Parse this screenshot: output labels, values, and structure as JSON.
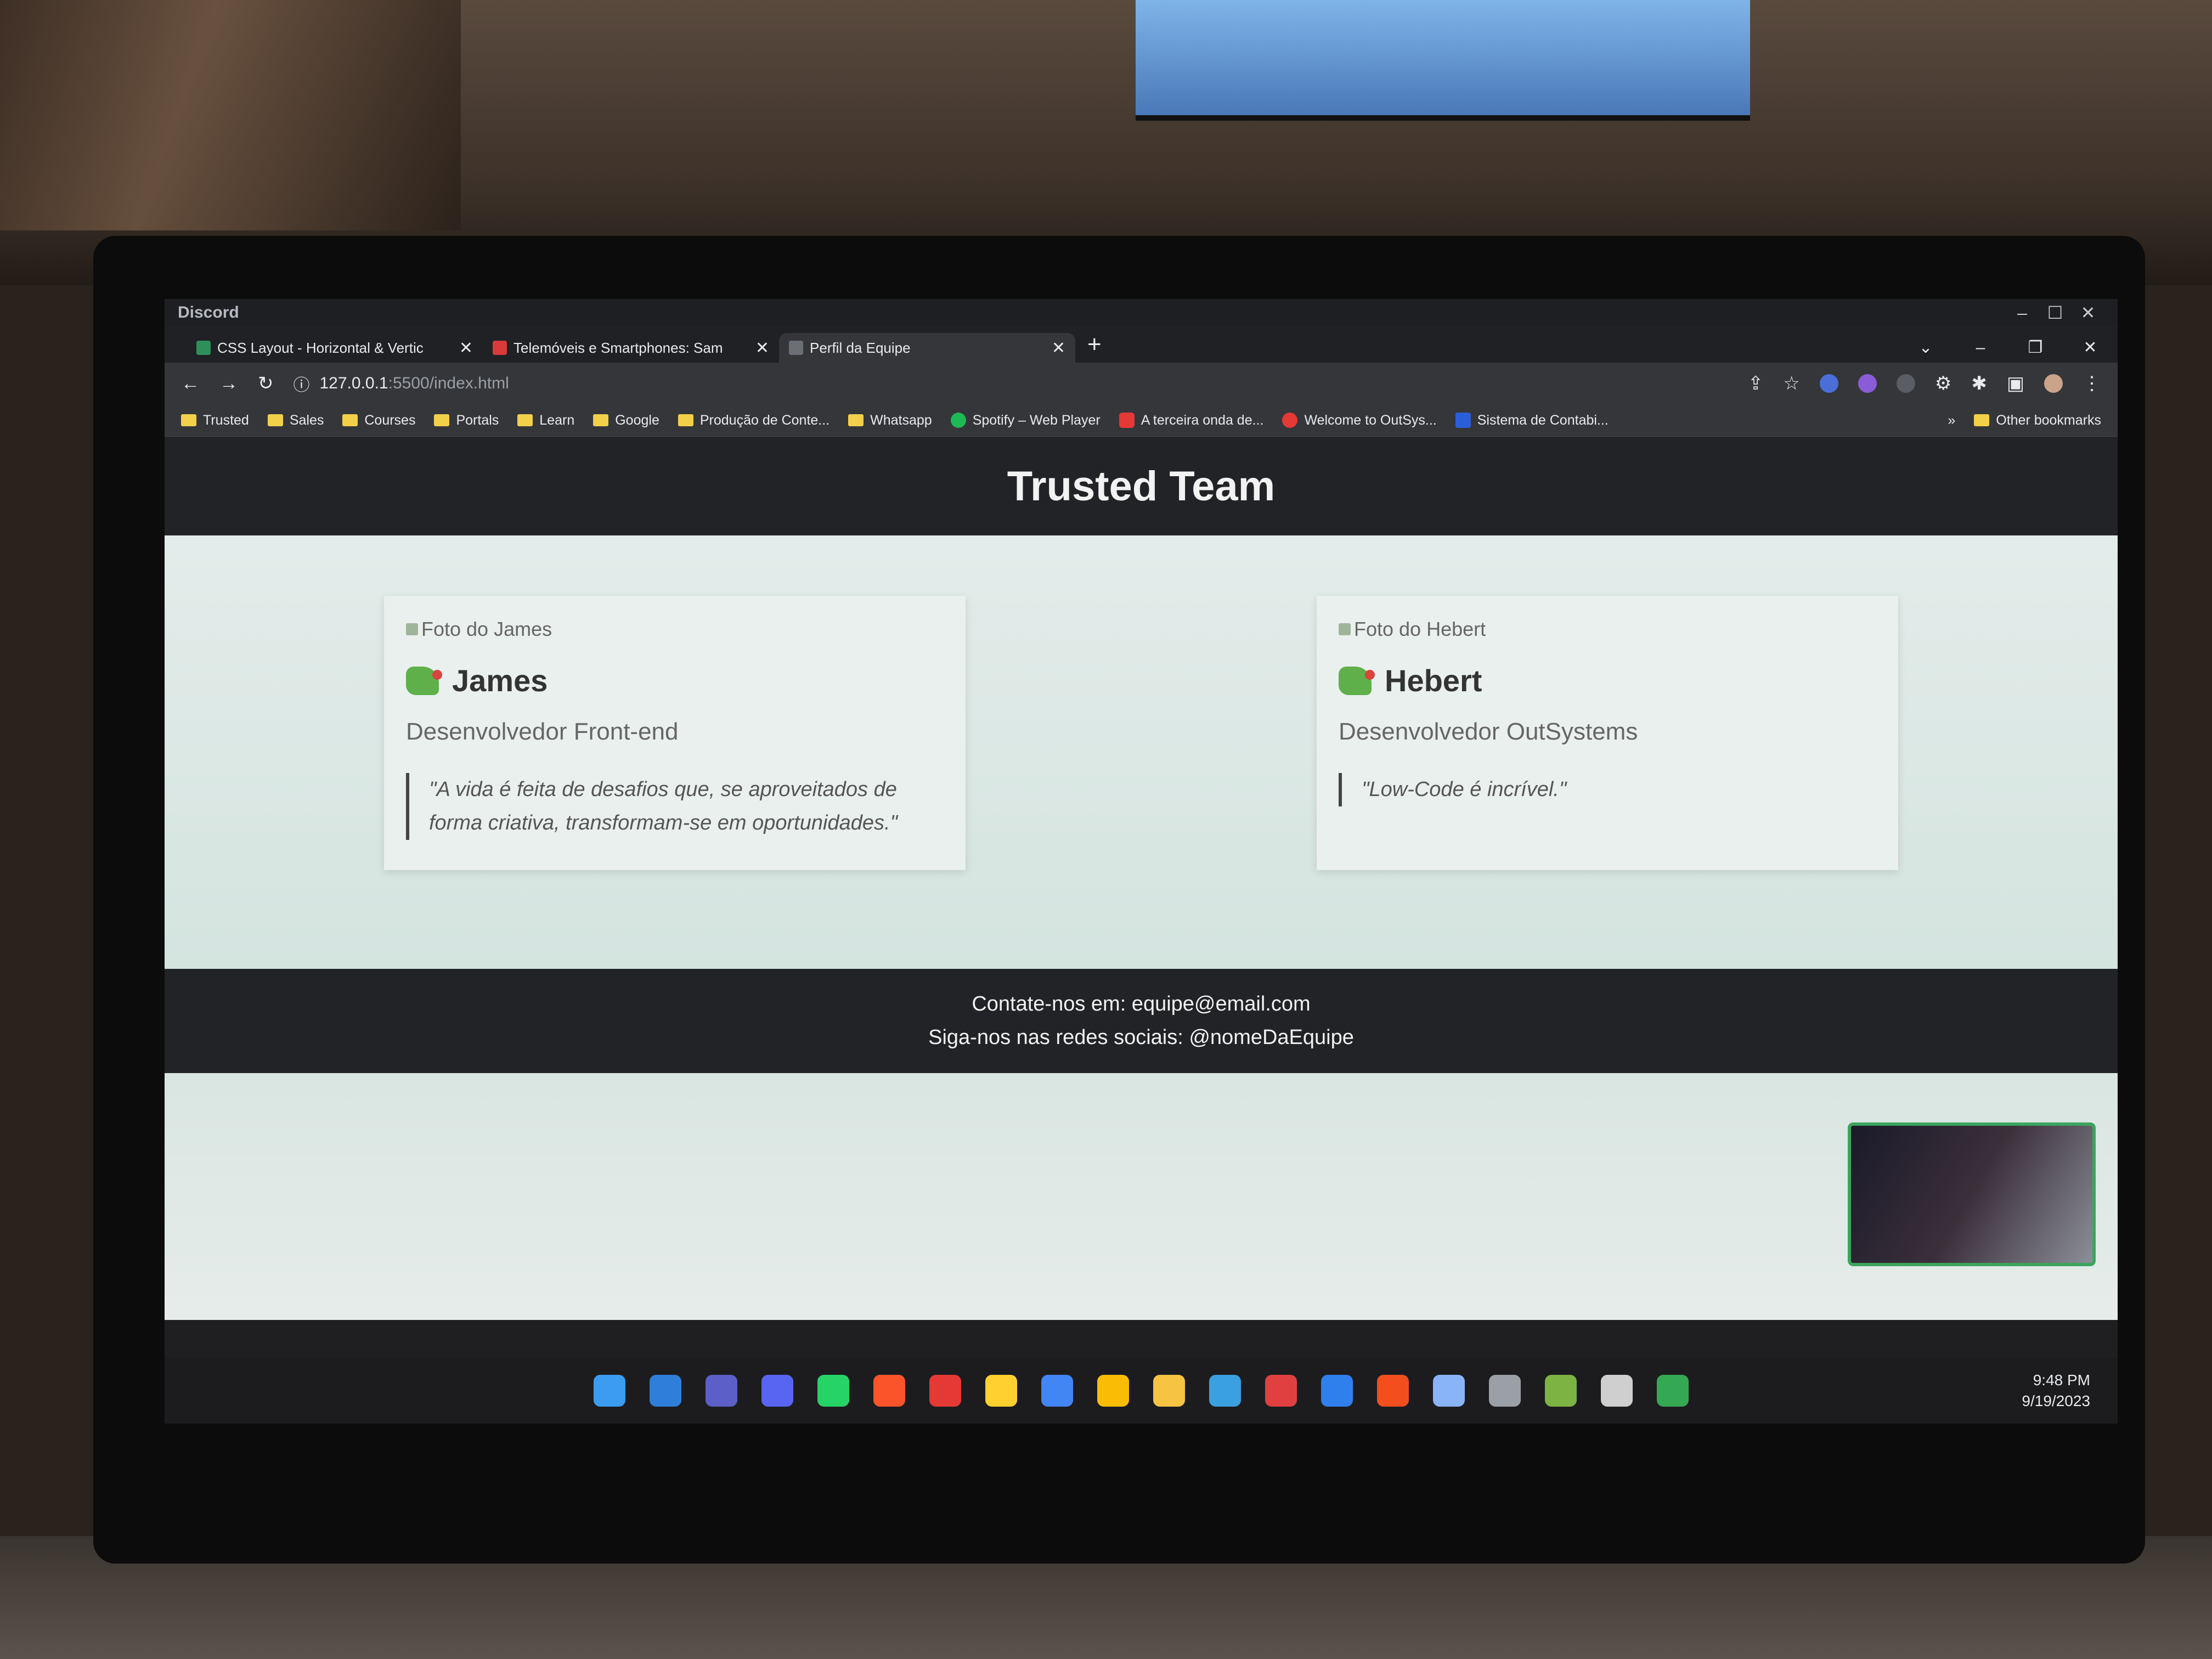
{
  "app_title": "Discord",
  "tabs": [
    {
      "label": "CSS Layout - Horizontal & Vertic",
      "close": "✕",
      "favicon_color": "#2f8f5b"
    },
    {
      "label": "Telemóveis e Smartphones: Sam",
      "close": "✕",
      "favicon_color": "#d93a3a"
    },
    {
      "label": "Perfil da Equipe",
      "close": "✕",
      "favicon_color": "#6b6f76",
      "active": true
    }
  ],
  "new_tab": "+",
  "address": {
    "host": "127.0.0.1",
    "path": ":5500/index.html"
  },
  "bookmarks": [
    {
      "label": "Trusted",
      "icon": "folder-icon"
    },
    {
      "label": "Sales",
      "icon": "folder-icon"
    },
    {
      "label": "Courses",
      "icon": "folder-icon"
    },
    {
      "label": "Portals",
      "icon": "folder-icon"
    },
    {
      "label": "Learn",
      "icon": "folder-icon"
    },
    {
      "label": "Google",
      "icon": "folder-icon"
    },
    {
      "label": "Produção de Conte...",
      "icon": "folder-icon"
    },
    {
      "label": "Whatsapp",
      "icon": "folder-icon"
    },
    {
      "label": "Spotify – Web Player",
      "icon": "spotify-icon",
      "color": "#1db954"
    },
    {
      "label": "A terceira onda de...",
      "icon": "youtube-icon",
      "color": "#e53935"
    },
    {
      "label": "Welcome to OutSys...",
      "icon": "outsystems-icon",
      "color": "#e53935"
    },
    {
      "label": "Sistema de Contabi...",
      "icon": "n-icon",
      "color": "#2b5fd9"
    }
  ],
  "bookmarks_more": "»",
  "other_bookmarks": "Other bookmarks",
  "site": {
    "title": "Trusted Team",
    "members": [
      {
        "photo_alt": "Foto do James",
        "name": "James",
        "role": "Desenvolvedor Front-end",
        "quote": "\"A vida é feita de desafios que, se aproveitados de forma criativa, transformam-se em oportunidades.\""
      },
      {
        "photo_alt": "Foto do Hebert",
        "name": "Hebert",
        "role": "Desenvolvedor OutSystems",
        "quote": "\"Low-Code é incrível.\""
      }
    ],
    "footer": {
      "contact": "Contate-nos em: equipe@email.com",
      "social": "Siga-nos nas redes sociais: @nomeDaEquipe"
    }
  },
  "taskbar": {
    "icons": [
      {
        "name": "windows-start-icon",
        "color": "#3b9cf0"
      },
      {
        "name": "calendar-icon",
        "color": "#2f7fd9"
      },
      {
        "name": "teams-icon",
        "color": "#5b5fc7"
      },
      {
        "name": "discord-icon",
        "color": "#5865f2"
      },
      {
        "name": "whatsapp-icon",
        "color": "#25d366"
      },
      {
        "name": "brave-icon",
        "color": "#fb542b"
      },
      {
        "name": "screen-recorder-icon",
        "color": "#e53935"
      },
      {
        "name": "miro-icon",
        "color": "#ffd02f"
      },
      {
        "name": "chrome-dev-icon",
        "color": "#4285f4"
      },
      {
        "name": "chrome-icon",
        "color": "#fbbc05"
      },
      {
        "name": "file-explorer-icon",
        "color": "#f6c343"
      },
      {
        "name": "paint-icon",
        "color": "#3aa0e0"
      },
      {
        "name": "cloud-icon",
        "color": "#e04040"
      },
      {
        "name": "vscode-icon",
        "color": "#2f80ed"
      },
      {
        "name": "figma-icon",
        "color": "#f24e1e"
      },
      {
        "name": "outsystems-studio-icon",
        "color": "#8ab4f8"
      },
      {
        "name": "app-icon",
        "color": "#9aa0a6"
      },
      {
        "name": "notepad-icon",
        "color": "#7cb342"
      },
      {
        "name": "obs-icon",
        "color": "#cfcfcf"
      },
      {
        "name": "chrome-profile-icon",
        "color": "#34a853"
      }
    ],
    "time": "9:48 PM",
    "date": "9/19/2023"
  }
}
